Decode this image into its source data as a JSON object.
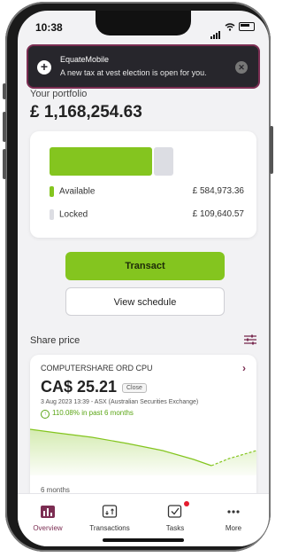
{
  "status_bar": {
    "time": "10:38"
  },
  "notification": {
    "app": "EquateMobile",
    "message": "A new tax at vest election is open for you."
  },
  "portfolio": {
    "label": "Your portfolio",
    "value": "£ 1,168,254.63",
    "available_label": "Available",
    "available_value": "£ 584,973.36",
    "locked_label": "Locked",
    "locked_value": "£ 109,640.57",
    "available_share": 0.84
  },
  "actions": {
    "transact": "Transact",
    "view_schedule": "View schedule"
  },
  "share_price": {
    "section_label": "Share price",
    "company": "COMPUTERSHARE ORD CPU",
    "price": "CA$ 25.21",
    "badge": "Close",
    "date": "3 Aug 2023 13:39 - ASX (Australian Securities Exchange)",
    "change": "110.08% in past 6 months",
    "period": "6 months"
  },
  "tabs": [
    {
      "label": "Overview"
    },
    {
      "label": "Transactions"
    },
    {
      "label": "Tasks"
    },
    {
      "label": "More"
    }
  ],
  "colors": {
    "accent": "#84c51f",
    "brand": "#7b2d52",
    "notification_bg": "#27262c"
  }
}
